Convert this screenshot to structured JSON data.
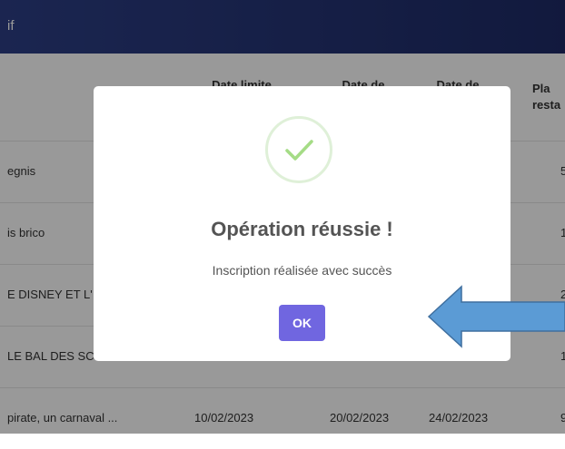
{
  "header": {
    "title": "if"
  },
  "table": {
    "columns": [
      "",
      "Date limite",
      "Date de",
      "Date de",
      "Pla\nresta"
    ],
    "rows": [
      {
        "name": "egnis",
        "d1": "",
        "d2": "",
        "d3": "",
        "places": "5"
      },
      {
        "name": "is brico",
        "d1": "",
        "d2": "",
        "d3": "",
        "places": "1"
      },
      {
        "name": "E DISNEY ET L'",
        "d1": "",
        "d2": "",
        "d3": "",
        "places": "2"
      },
      {
        "name": "LE BAL DES SC",
        "d1": "",
        "d2": "",
        "d3": "",
        "places": "1"
      },
      {
        "name": "pirate, un carnaval ...",
        "d1": "10/02/2023",
        "d2": "20/02/2023",
        "d3": "24/02/2023",
        "places": "9"
      }
    ]
  },
  "modal": {
    "title": "Opération réussie !",
    "message": "Inscription réalisée avec succès",
    "ok_label": "OK",
    "icon": "success-check-icon",
    "button_color": "#7066e0",
    "check_color": "#a5dc86"
  },
  "annotation": {
    "icon": "arrow-left-icon",
    "color": "#5b9bd5"
  }
}
